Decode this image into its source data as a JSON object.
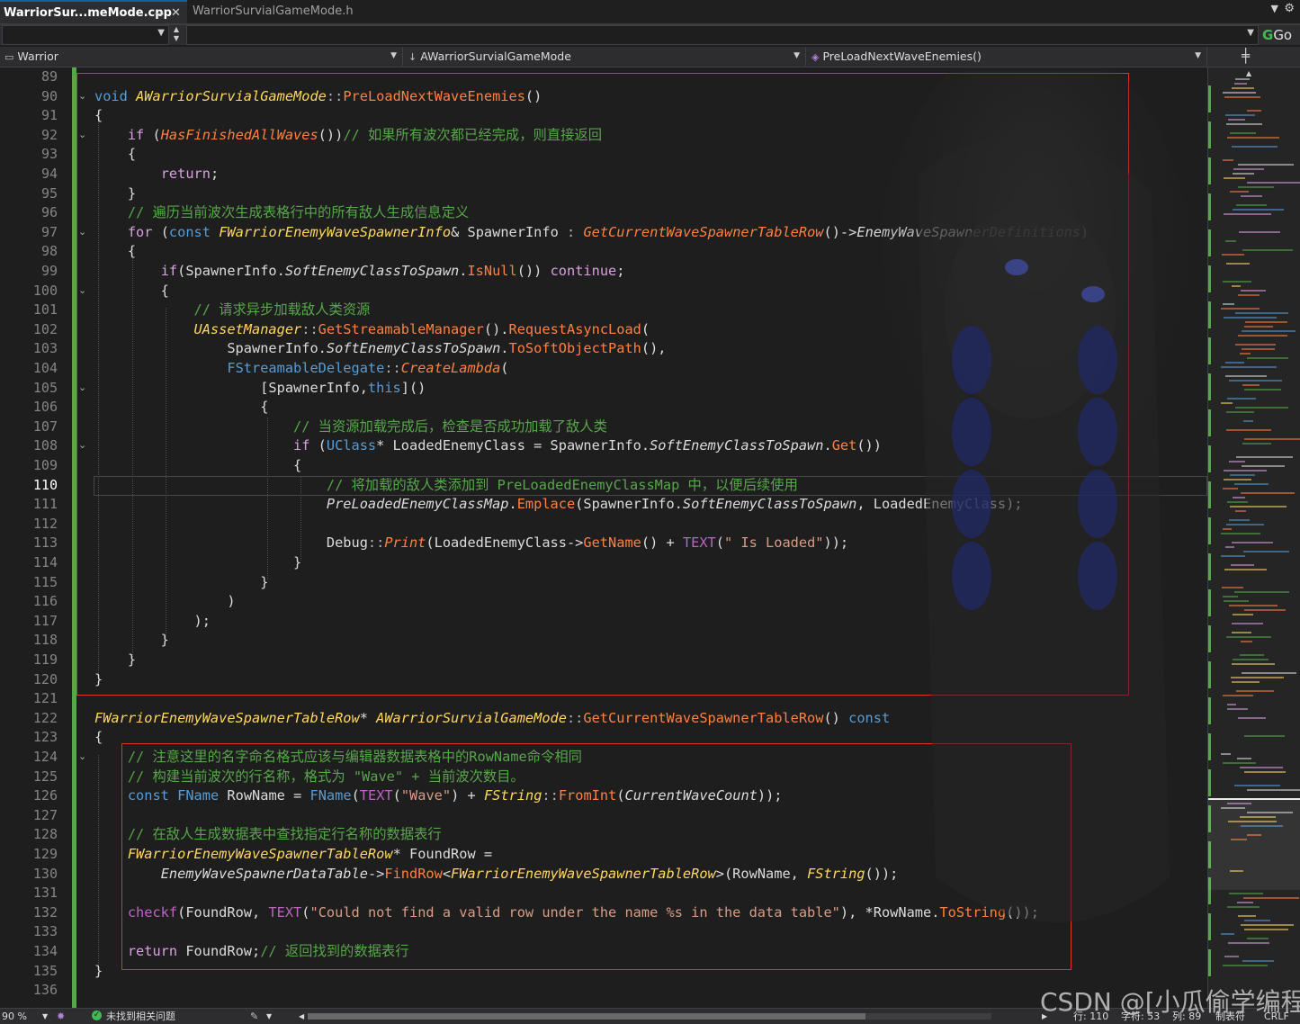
{
  "tabs": [
    {
      "label": "WarriorSur...meMode.cpp",
      "active": true
    },
    {
      "label": "WarriorSurvialGameMode.h",
      "active": false
    }
  ],
  "toolbar": {
    "go_label": "Go"
  },
  "nav": {
    "project": "Warrior",
    "class": "AWarriorSurvialGameMode",
    "member": "PreLoadNextWaveEnemies()"
  },
  "editor": {
    "current_line": 110,
    "line_numbers": [
      "89",
      "90",
      "91",
      "92",
      "93",
      "94",
      "95",
      "96",
      "97",
      "98",
      "99",
      "100",
      "101",
      "102",
      "103",
      "104",
      "105",
      "106",
      "107",
      "108",
      "109",
      "110",
      "111",
      "112",
      "113",
      "114",
      "115",
      "116",
      "117",
      "118",
      "119",
      "120",
      "121",
      "122",
      "123",
      "124",
      "125",
      "126",
      "127",
      "128",
      "129",
      "130",
      "131",
      "132",
      "133",
      "134",
      "135",
      "136"
    ],
    "code": [
      [],
      [
        [
          "kw",
          "void"
        ],
        [
          "tx",
          " "
        ],
        [
          "ty",
          "AWarriorSurvialGameMode"
        ],
        [
          "op",
          "::"
        ],
        [
          "fn",
          "PreLoadNextWaveEnemies"
        ],
        [
          "tx",
          "()"
        ]
      ],
      [
        [
          "tx",
          "{"
        ]
      ],
      [
        [
          "tx",
          "    "
        ],
        [
          "kp",
          "if"
        ],
        [
          "tx",
          " ("
        ],
        [
          "fi",
          "HasFinishedAllWaves"
        ],
        [
          "tx",
          "())"
        ],
        [
          "cm",
          "// 如果所有波次都已经完成，则直接返回"
        ]
      ],
      [
        [
          "tx",
          "    {"
        ]
      ],
      [
        [
          "tx",
          "        "
        ],
        [
          "kp",
          "return"
        ],
        [
          "tx",
          ";"
        ]
      ],
      [
        [
          "tx",
          "    }"
        ]
      ],
      [
        [
          "tx",
          "    "
        ],
        [
          "cm",
          "// 遍历当前波次生成表格行中的所有敌人生成信息定义"
        ]
      ],
      [
        [
          "tx",
          "    "
        ],
        [
          "kp",
          "for"
        ],
        [
          "tx",
          " ("
        ],
        [
          "kw",
          "const"
        ],
        [
          "tx",
          " "
        ],
        [
          "ty",
          "FWarriorEnemyWaveSpawnerInfo"
        ],
        [
          "tx",
          "& SpawnerInfo "
        ],
        [
          "op",
          ":"
        ],
        [
          "tx",
          " "
        ],
        [
          "fi",
          "GetCurrentWaveSpawnerTableRow"
        ],
        [
          "tx",
          "()->"
        ],
        [
          "it",
          "EnemyWaveSpawnerDefinitions"
        ],
        [
          "tx",
          ")"
        ]
      ],
      [
        [
          "tx",
          "    {"
        ]
      ],
      [
        [
          "tx",
          "        "
        ],
        [
          "kp",
          "if"
        ],
        [
          "tx",
          "(SpawnerInfo."
        ],
        [
          "it",
          "SoftEnemyClassToSpawn"
        ],
        [
          "tx",
          "."
        ],
        [
          "fn",
          "IsNull"
        ],
        [
          "tx",
          "()) "
        ],
        [
          "kp",
          "continue"
        ],
        [
          "tx",
          ";"
        ]
      ],
      [
        [
          "tx",
          "        {"
        ]
      ],
      [
        [
          "tx",
          "            "
        ],
        [
          "cm",
          "// 请求异步加载敌人类资源"
        ]
      ],
      [
        [
          "tx",
          "            "
        ],
        [
          "ty",
          "UAssetManager"
        ],
        [
          "op",
          "::"
        ],
        [
          "fn",
          "GetStreamableManager"
        ],
        [
          "tx",
          "()."
        ],
        [
          "fn",
          "RequestAsyncLoad"
        ],
        [
          "tx",
          "("
        ]
      ],
      [
        [
          "tx",
          "                SpawnerInfo."
        ],
        [
          "it",
          "SoftEnemyClassToSpawn"
        ],
        [
          "tx",
          "."
        ],
        [
          "fn",
          "ToSoftObjectPath"
        ],
        [
          "tx",
          "(),"
        ]
      ],
      [
        [
          "tx",
          "                "
        ],
        [
          "kw",
          "FStreamableDelegate"
        ],
        [
          "op",
          "::"
        ],
        [
          "fi",
          "CreateLambda"
        ],
        [
          "tx",
          "("
        ]
      ],
      [
        [
          "tx",
          "                    [SpawnerInfo,"
        ],
        [
          "kw",
          "this"
        ],
        [
          "tx",
          "]()"
        ]
      ],
      [
        [
          "tx",
          "                    {"
        ]
      ],
      [
        [
          "tx",
          "                        "
        ],
        [
          "cm",
          "// 当资源加载完成后，检查是否成功加载了敌人类"
        ]
      ],
      [
        [
          "tx",
          "                        "
        ],
        [
          "kp",
          "if"
        ],
        [
          "tx",
          " ("
        ],
        [
          "kw",
          "UClass"
        ],
        [
          "tx",
          "* LoadedEnemyClass = SpawnerInfo."
        ],
        [
          "it",
          "SoftEnemyClassToSpawn"
        ],
        [
          "tx",
          "."
        ],
        [
          "fn",
          "Get"
        ],
        [
          "tx",
          "())"
        ]
      ],
      [
        [
          "tx",
          "                        {"
        ]
      ],
      [
        [
          "tx",
          "                            "
        ],
        [
          "cm",
          "// 将加载的敌人类添加到 PreLoadedEnemyClassMap 中，以便后续使用"
        ]
      ],
      [
        [
          "tx",
          "                            "
        ],
        [
          "it",
          "PreLoadedEnemyClassMap"
        ],
        [
          "tx",
          "."
        ],
        [
          "fn",
          "Emplace"
        ],
        [
          "tx",
          "(SpawnerInfo."
        ],
        [
          "it",
          "SoftEnemyClassToSpawn"
        ],
        [
          "tx",
          ", LoadedEnemyClass);"
        ]
      ],
      [],
      [
        [
          "tx",
          "                            Debug"
        ],
        [
          "op",
          "::"
        ],
        [
          "fi",
          "Print"
        ],
        [
          "tx",
          "(LoadedEnemyClass->"
        ],
        [
          "fn",
          "GetName"
        ],
        [
          "tx",
          "() + "
        ],
        [
          "mac",
          "TEXT"
        ],
        [
          "tx",
          "("
        ],
        [
          "str",
          "\" Is Loaded\""
        ],
        [
          "tx",
          "));"
        ]
      ],
      [
        [
          "tx",
          "                        }"
        ]
      ],
      [
        [
          "tx",
          "                    }"
        ]
      ],
      [
        [
          "tx",
          "                )"
        ]
      ],
      [
        [
          "tx",
          "            );"
        ]
      ],
      [
        [
          "tx",
          "        }"
        ]
      ],
      [
        [
          "tx",
          "    }"
        ]
      ],
      [
        [
          "tx",
          "}"
        ]
      ],
      [],
      [
        [
          "ty",
          "FWarriorEnemyWaveSpawnerTableRow"
        ],
        [
          "tx",
          "* "
        ],
        [
          "ty",
          "AWarriorSurvialGameMode"
        ],
        [
          "op",
          "::"
        ],
        [
          "fn",
          "GetCurrentWaveSpawnerTableRow"
        ],
        [
          "tx",
          "() "
        ],
        [
          "kw",
          "const"
        ]
      ],
      [
        [
          "tx",
          "{"
        ]
      ],
      [
        [
          "tx",
          "    "
        ],
        [
          "cm",
          "// 注意这里的名字命名格式应该与编辑器数据表格中的RowName命令相同"
        ]
      ],
      [
        [
          "tx",
          "    "
        ],
        [
          "cm",
          "// 构建当前波次的行名称，格式为 \"Wave\" + 当前波次数目。"
        ]
      ],
      [
        [
          "tx",
          "    "
        ],
        [
          "kw",
          "const"
        ],
        [
          "tx",
          " "
        ],
        [
          "kw",
          "FName"
        ],
        [
          "tx",
          " RowName = "
        ],
        [
          "kw",
          "FName"
        ],
        [
          "tx",
          "("
        ],
        [
          "mac",
          "TEXT"
        ],
        [
          "tx",
          "("
        ],
        [
          "str",
          "\"Wave\""
        ],
        [
          "tx",
          ") + "
        ],
        [
          "ty",
          "FString"
        ],
        [
          "op",
          "::"
        ],
        [
          "fn",
          "FromInt"
        ],
        [
          "tx",
          "("
        ],
        [
          "it",
          "CurrentWaveCount"
        ],
        [
          "tx",
          "));"
        ]
      ],
      [],
      [
        [
          "tx",
          "    "
        ],
        [
          "cm",
          "// 在敌人生成数据表中查找指定行名称的数据表行"
        ]
      ],
      [
        [
          "tx",
          "    "
        ],
        [
          "ty",
          "FWarriorEnemyWaveSpawnerTableRow"
        ],
        [
          "tx",
          "* FoundRow ="
        ]
      ],
      [
        [
          "tx",
          "        "
        ],
        [
          "it",
          "EnemyWaveSpawnerDataTable"
        ],
        [
          "tx",
          "->"
        ],
        [
          "fn",
          "FindRow"
        ],
        [
          "tx",
          "<"
        ],
        [
          "ty",
          "FWarriorEnemyWaveSpawnerTableRow"
        ],
        [
          "tx",
          ">(RowName, "
        ],
        [
          "ty",
          "FString"
        ],
        [
          "tx",
          "());"
        ]
      ],
      [],
      [
        [
          "tx",
          "    "
        ],
        [
          "mac",
          "checkf"
        ],
        [
          "tx",
          "(FoundRow, "
        ],
        [
          "mac",
          "TEXT"
        ],
        [
          "tx",
          "("
        ],
        [
          "str",
          "\"Could not find a valid row under the name %s in the data table\""
        ],
        [
          "tx",
          "), *RowName."
        ],
        [
          "fn",
          "ToString"
        ],
        [
          "tx",
          "());"
        ]
      ],
      [],
      [
        [
          "tx",
          "    "
        ],
        [
          "kp",
          "return"
        ],
        [
          "tx",
          " FoundRow;"
        ],
        [
          "cm",
          "// 返回找到的数据表行"
        ]
      ],
      [
        [
          "tx",
          "}"
        ]
      ],
      []
    ]
  },
  "status": {
    "zoom": "90 %",
    "issues": "未找到相关问题",
    "row": "行: 110",
    "col": "字符: 53",
    "ch": "列: 89",
    "whitespace": "制表符",
    "eol": "CRLF"
  },
  "watermark": "CSDN @[小瓜偷学编程]",
  "colors": {
    "accent": "#0e639c",
    "change_bar": "#57a64a",
    "highlight_box": "#e0322b",
    "issues_ok": "#3fb950"
  },
  "icons": [
    "pin-icon",
    "close-icon",
    "overflow-dropdown-icon",
    "settings-icon",
    "go-icon",
    "project-icon",
    "class-icon",
    "method-icon",
    "split-editor-icon",
    "ai-assist-icon",
    "check-circle-icon",
    "code-cleanup-icon"
  ]
}
